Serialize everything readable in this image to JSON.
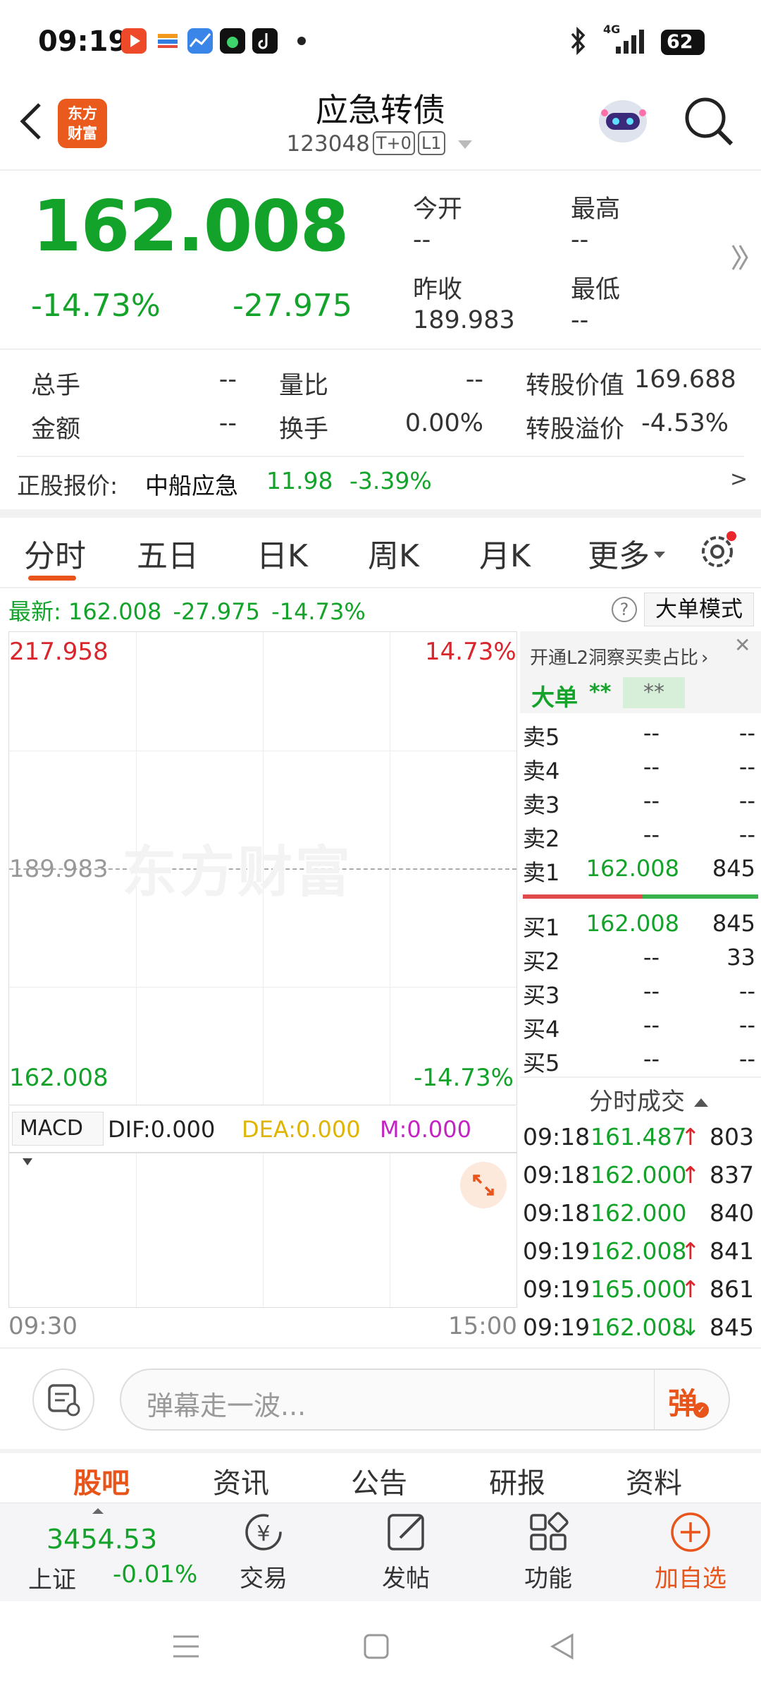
{
  "status_bar": {
    "time": "09:19",
    "network": "4G",
    "battery": "62",
    "app_icons": [
      "video-app-icon",
      "wallet-app-icon",
      "chart-app-icon",
      "music-app-icon",
      "tiktok-icon"
    ]
  },
  "header": {
    "logo_line1": "东方",
    "logo_line2": "财富",
    "title": "应急转债",
    "code": "123048",
    "tag1": "T+0",
    "tag2": "L1"
  },
  "quote": {
    "price": "162.008",
    "change_pct": "-14.73%",
    "change_abs": "-27.975",
    "open_label": "今开",
    "open_value": "--",
    "high_label": "最高",
    "high_value": "--",
    "prev_close_label": "昨收",
    "prev_close_value": "189.983",
    "low_label": "最低",
    "low_value": "--"
  },
  "stats": {
    "volume_label": "总手",
    "volume_value": "--",
    "ratio_label": "量比",
    "ratio_value": "--",
    "conv_value_label": "转股价值",
    "conv_value_value": "169.688",
    "amount_label": "金额",
    "amount_value": "--",
    "turnover_label": "换手",
    "turnover_value": "0.00%",
    "premium_label": "转股溢价",
    "premium_value": "-4.53%"
  },
  "underlying": {
    "label": "正股报价:",
    "name": "中船应急",
    "price": "11.98",
    "change": "-3.39%",
    "arrow": ">"
  },
  "tabs": [
    "分时",
    "五日",
    "日K",
    "周K",
    "月K",
    "更多"
  ],
  "active_tab": "分时",
  "latest_bar": {
    "label": "最新:",
    "price": "162.008",
    "change": "-27.975",
    "pct": "-14.73%",
    "help": "?",
    "mode_button": "大单模式"
  },
  "chart": {
    "y_top": "217.958",
    "y_top_pct": "14.73%",
    "y_mid": "189.983",
    "y_bottom": "162.008",
    "y_bottom_pct": "-14.73%",
    "watermark": "东方财富",
    "indicator": "MACD",
    "dif": "DIF:0.000",
    "dea": "DEA:0.000",
    "m": "M:0.000",
    "x_start": "09:30",
    "x_end": "15:00"
  },
  "order_book": {
    "promo": "开通L2洞察买卖占比",
    "big_order_label": "大单",
    "big_order_v1": "**",
    "big_order_v2": "**",
    "asks": [
      {
        "label": "卖5",
        "price": "--",
        "vol": "--"
      },
      {
        "label": "卖4",
        "price": "--",
        "vol": "--"
      },
      {
        "label": "卖3",
        "price": "--",
        "vol": "--"
      },
      {
        "label": "卖2",
        "price": "--",
        "vol": "--"
      },
      {
        "label": "卖1",
        "price": "162.008",
        "vol": "845"
      }
    ],
    "bids": [
      {
        "label": "买1",
        "price": "162.008",
        "vol": "845"
      },
      {
        "label": "买2",
        "price": "--",
        "vol": "33"
      },
      {
        "label": "买3",
        "price": "--",
        "vol": "--"
      },
      {
        "label": "买4",
        "price": "--",
        "vol": "--"
      },
      {
        "label": "买5",
        "price": "--",
        "vol": "--"
      }
    ],
    "ticks_title": "分时成交",
    "ticks": [
      {
        "time": "09:18",
        "price": "161.487",
        "arrow": "↑",
        "vol": "803"
      },
      {
        "time": "09:18",
        "price": "162.000",
        "arrow": "↑",
        "vol": "837"
      },
      {
        "time": "09:18",
        "price": "162.000",
        "arrow": "",
        "vol": "840"
      },
      {
        "time": "09:19",
        "price": "162.008",
        "arrow": "↑",
        "vol": "841"
      },
      {
        "time": "09:19",
        "price": "165.000",
        "arrow": "↑",
        "vol": "861"
      },
      {
        "time": "09:19",
        "price": "162.008",
        "arrow": "↓",
        "vol": "845"
      }
    ]
  },
  "comment_bar": {
    "placeholder": "弹幕走一波...",
    "danmaku_button": "弹"
  },
  "section_tabs": [
    "股吧",
    "资讯",
    "公告",
    "研报",
    "资料"
  ],
  "dock": {
    "index_value": "3454.53",
    "index_name": "上证",
    "index_change": "-0.01%",
    "trade": "交易",
    "post": "发帖",
    "functions": "功能",
    "add_watch": "加自选"
  },
  "colors": {
    "up": "#d8262c",
    "down": "#14a32a",
    "accent": "#e8541a"
  }
}
